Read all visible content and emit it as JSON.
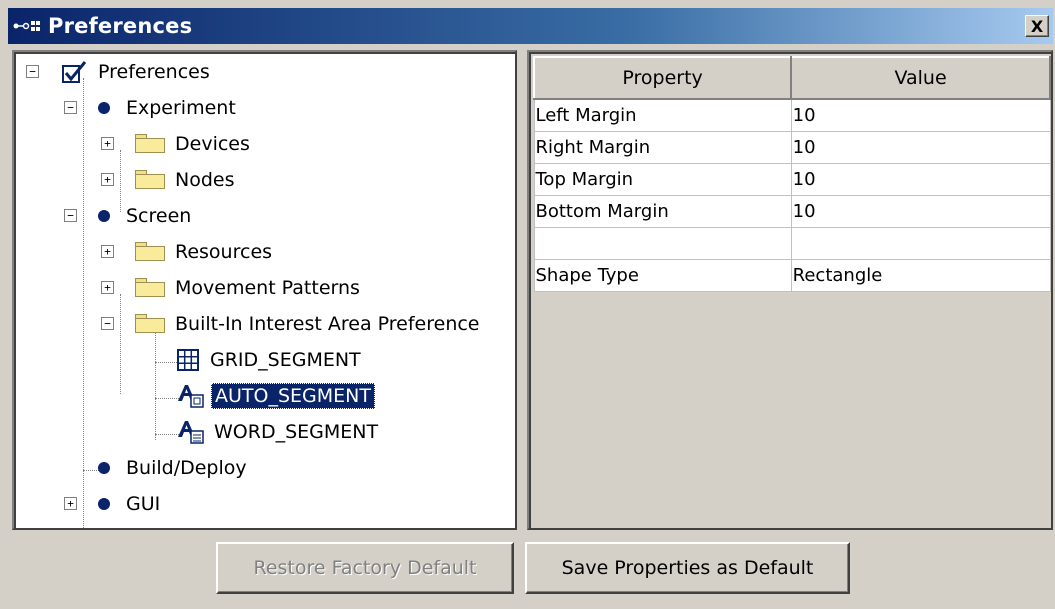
{
  "window": {
    "title": "Preferences",
    "close_glyph": "X"
  },
  "tree": {
    "items": [
      {
        "label": "Preferences",
        "icon": "checkbox-icon",
        "expander": "−",
        "selected": false
      },
      {
        "label": "Experiment",
        "icon": "bullet-icon",
        "expander": "−",
        "selected": false
      },
      {
        "label": "Devices",
        "icon": "folder-icon",
        "expander": "+",
        "selected": false
      },
      {
        "label": "Nodes",
        "icon": "folder-icon",
        "expander": "+",
        "selected": false
      },
      {
        "label": "Screen",
        "icon": "bullet-icon",
        "expander": "−",
        "selected": false
      },
      {
        "label": "Resources",
        "icon": "folder-icon",
        "expander": "+",
        "selected": false
      },
      {
        "label": "Movement Patterns",
        "icon": "folder-icon",
        "expander": "+",
        "selected": false
      },
      {
        "label": "Built-In Interest Area Preference",
        "icon": "open-folder-icon",
        "expander": "−",
        "selected": false
      },
      {
        "label": "GRID_SEGMENT",
        "icon": "grid-icon",
        "expander": "",
        "selected": false
      },
      {
        "label": "AUTO_SEGMENT",
        "icon": "auto-segment-icon",
        "expander": "",
        "selected": true
      },
      {
        "label": "WORD_SEGMENT",
        "icon": "word-segment-icon",
        "expander": "",
        "selected": false
      },
      {
        "label": "Build/Deploy",
        "icon": "bullet-icon",
        "expander": "",
        "selected": false
      },
      {
        "label": "GUI",
        "icon": "bullet-icon",
        "expander": "+",
        "selected": false
      }
    ]
  },
  "properties": {
    "columns": [
      "Property",
      "Value"
    ],
    "rows": [
      [
        "Left Margin",
        "10"
      ],
      [
        "Right Margin",
        "10"
      ],
      [
        "Top Margin",
        "10"
      ],
      [
        "Bottom Margin",
        "10"
      ],
      [
        "",
        ""
      ],
      [
        "Shape Type",
        "Rectangle"
      ]
    ]
  },
  "buttons": {
    "restore_label": "Restore Factory Default",
    "restore_enabled": false,
    "save_label": "Save Properties as Default"
  },
  "colors": {
    "titlebar": "#0a246a",
    "selection": "#0a246a",
    "face": "#d4d0c8",
    "bullet": "#0a246a"
  }
}
